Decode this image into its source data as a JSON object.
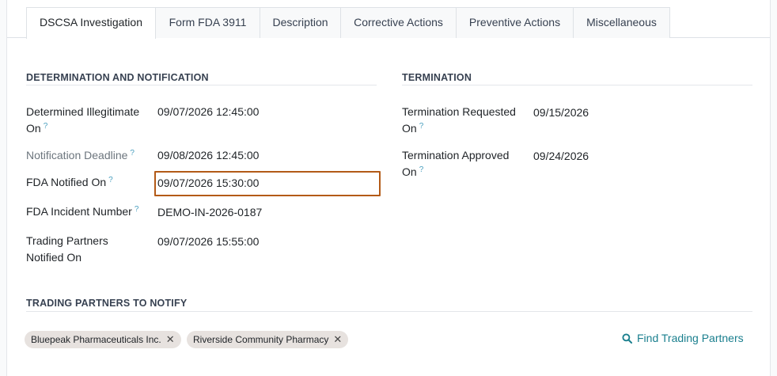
{
  "tabs": [
    {
      "label": "DSCSA Investigation",
      "active": true
    },
    {
      "label": "Form FDA 3911",
      "active": false
    },
    {
      "label": "Description",
      "active": false
    },
    {
      "label": "Corrective Actions",
      "active": false
    },
    {
      "label": "Preventive Actions",
      "active": false
    },
    {
      "label": "Miscellaneous",
      "active": false
    }
  ],
  "determination": {
    "title": "DETERMINATION AND NOTIFICATION",
    "fields": [
      {
        "label_line1": "Determined Illegitimate",
        "label_line2": "On",
        "help": "?",
        "value": "09/07/2026 12:45:00"
      },
      {
        "label": "Notification Deadline",
        "help": "?",
        "value": "09/08/2026 12:45:00"
      },
      {
        "label": "FDA Notified On",
        "help": "?",
        "value": "09/07/2026 15:30:00"
      },
      {
        "label": "FDA Incident Number",
        "help": "?",
        "value": "DEMO-IN-2026-0187"
      },
      {
        "label_line1": "Trading Partners",
        "label_line2": "Notified On",
        "value": "09/07/2026 15:55:00"
      }
    ]
  },
  "termination": {
    "title": "TERMINATION",
    "fields": [
      {
        "label_line1": "Termination Requested",
        "label_line2": "On",
        "help": "?",
        "value": "09/15/2026"
      },
      {
        "label_line1": "Termination Approved",
        "label_line2": "On",
        "help": "?",
        "value": "09/24/2026"
      }
    ]
  },
  "trading_partners": {
    "title": "TRADING PARTNERS TO NOTIFY",
    "tags": [
      {
        "label": "Bluepeak Pharmaceuticals Inc.",
        "remove": "✕"
      },
      {
        "label": "Riverside Community Pharmacy",
        "remove": "✕"
      }
    ],
    "find_label": "Find Trading Partners",
    "find_icon": "search-icon"
  },
  "colors": {
    "accent": "#1a7f8e",
    "highlight": "#b35a17",
    "help": "#4a9fbf",
    "tag_bg": "#e7e2df"
  }
}
